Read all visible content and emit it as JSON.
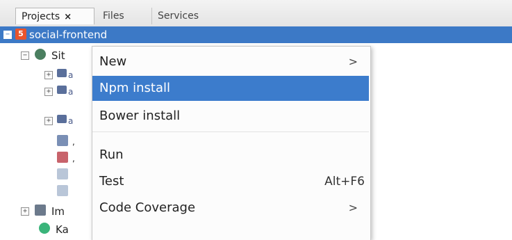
{
  "tabs": [
    {
      "label": "Projects",
      "close": "×"
    },
    {
      "label": "Files"
    },
    {
      "label": "Services"
    }
  ],
  "tree": {
    "root": {
      "label": "social-frontend",
      "expander": "−",
      "icon": "html5-project-icon",
      "icon_glyph": "5"
    },
    "children": [
      {
        "label": "Sit",
        "expander": "−",
        "icon": "site-root-icon"
      },
      {
        "label": "a",
        "expander": "+",
        "icon": "folder-icon"
      },
      {
        "label": "a",
        "expander": "+",
        "icon": "folder-icon"
      },
      {
        "label": "a",
        "expander": "+",
        "icon": "folder-icon"
      },
      {
        "label": ",",
        "icon": "config-file-icon"
      },
      {
        "label": ",",
        "icon": "image-file-icon"
      },
      {
        "label": "",
        "icon": "text-file-icon"
      },
      {
        "label": "",
        "icon": "text-file-icon"
      },
      {
        "label": "Im",
        "expander": "+",
        "icon": "important-files-icon"
      },
      {
        "label": "Ka",
        "icon": "karma-icon"
      }
    ]
  },
  "context_menu": {
    "items": [
      {
        "label": "New",
        "submenu_arrow": ">"
      },
      {
        "label": "Npm install",
        "highlighted": true
      },
      {
        "label": "Bower install"
      },
      {
        "label": "Run"
      },
      {
        "label": "Test",
        "accelerator": "Alt+F6"
      },
      {
        "label": "Code Coverage",
        "submenu_arrow": ">"
      }
    ]
  },
  "colors": {
    "selection": "#3c79c6",
    "menu_highlight": "#3c7ccc"
  }
}
